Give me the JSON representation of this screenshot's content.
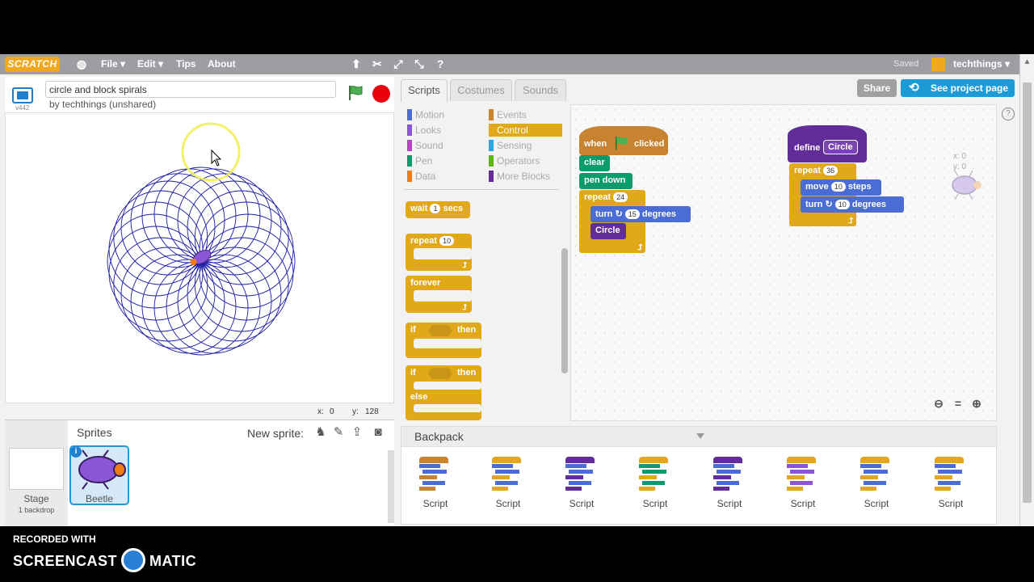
{
  "menu": {
    "logo": "SCRATCH",
    "items": [
      "File ▾",
      "Edit ▾",
      "Tips",
      "About"
    ],
    "saved": "Saved",
    "user": "techthings ▾"
  },
  "stage_header": {
    "version": "v442",
    "project_title": "circle and block spirals",
    "byline": "by techthings (unshared)"
  },
  "stage": {
    "mouse_x_label": "x:",
    "mouse_x": "0",
    "mouse_y_label": "y:",
    "mouse_y": "128"
  },
  "sprites_panel": {
    "label": "Sprites",
    "new_sprite": "New sprite:",
    "stage_label": "Stage",
    "stage_backdrops": "1 backdrop",
    "sprite_name": "Beetle"
  },
  "tabs": [
    "Scripts",
    "Costumes",
    "Sounds"
  ],
  "buttons": {
    "share": "Share",
    "see_project": "See project page"
  },
  "categories": [
    {
      "label": "Motion",
      "color": "#4a6cd4"
    },
    {
      "label": "Looks",
      "color": "#8a55d7"
    },
    {
      "label": "Sound",
      "color": "#bb42c3"
    },
    {
      "label": "Pen",
      "color": "#0e9a6c"
    },
    {
      "label": "Data",
      "color": "#ee7d16"
    },
    {
      "label": "Events",
      "color": "#c88330"
    },
    {
      "label": "Control",
      "color": "#e1a91a"
    },
    {
      "label": "Sensing",
      "color": "#2ca5e2"
    },
    {
      "label": "Operators",
      "color": "#5cb712"
    },
    {
      "label": "More Blocks",
      "color": "#632d99"
    }
  ],
  "palette": {
    "wait": "wait",
    "wait_val": "1",
    "secs": "secs",
    "repeat": "repeat",
    "repeat_val": "10",
    "forever": "forever",
    "if": "if",
    "then": "then",
    "if2": "if",
    "then2": "then",
    "else": "else"
  },
  "script_main": {
    "hat_when": "when",
    "hat_clicked": "clicked",
    "clear": "clear",
    "pen_down": "pen down",
    "repeat": "repeat",
    "repeat_val": "24",
    "turn": "turn",
    "turn_val": "15",
    "degrees": "degrees",
    "call": "Circle"
  },
  "script_define": {
    "define": "define",
    "name": "Circle",
    "repeat": "repeat",
    "repeat_val": "36",
    "move": "move",
    "move_val": "10",
    "steps": "steps",
    "turn": "turn",
    "turn_val": "10",
    "degrees": "degrees"
  },
  "sprite_info": {
    "x": "x: 0",
    "y": "y: 0"
  },
  "backpack": {
    "label": "Backpack",
    "items": [
      "Script",
      "Script",
      "Script",
      "Script",
      "Script",
      "Script",
      "Script",
      "Script"
    ]
  },
  "watermark": {
    "recorded": "RECORDED WITH",
    "brand_left": "SCREENCAST",
    "brand_right": "MATIC"
  },
  "colors": {
    "control": "#e1a91a",
    "events": "#c88330",
    "pen": "#0e9a6c",
    "motion": "#4a6cd4",
    "more_blocks": "#632d99",
    "spiral": "#1a1aa8",
    "accent": "#1e9bd7"
  }
}
